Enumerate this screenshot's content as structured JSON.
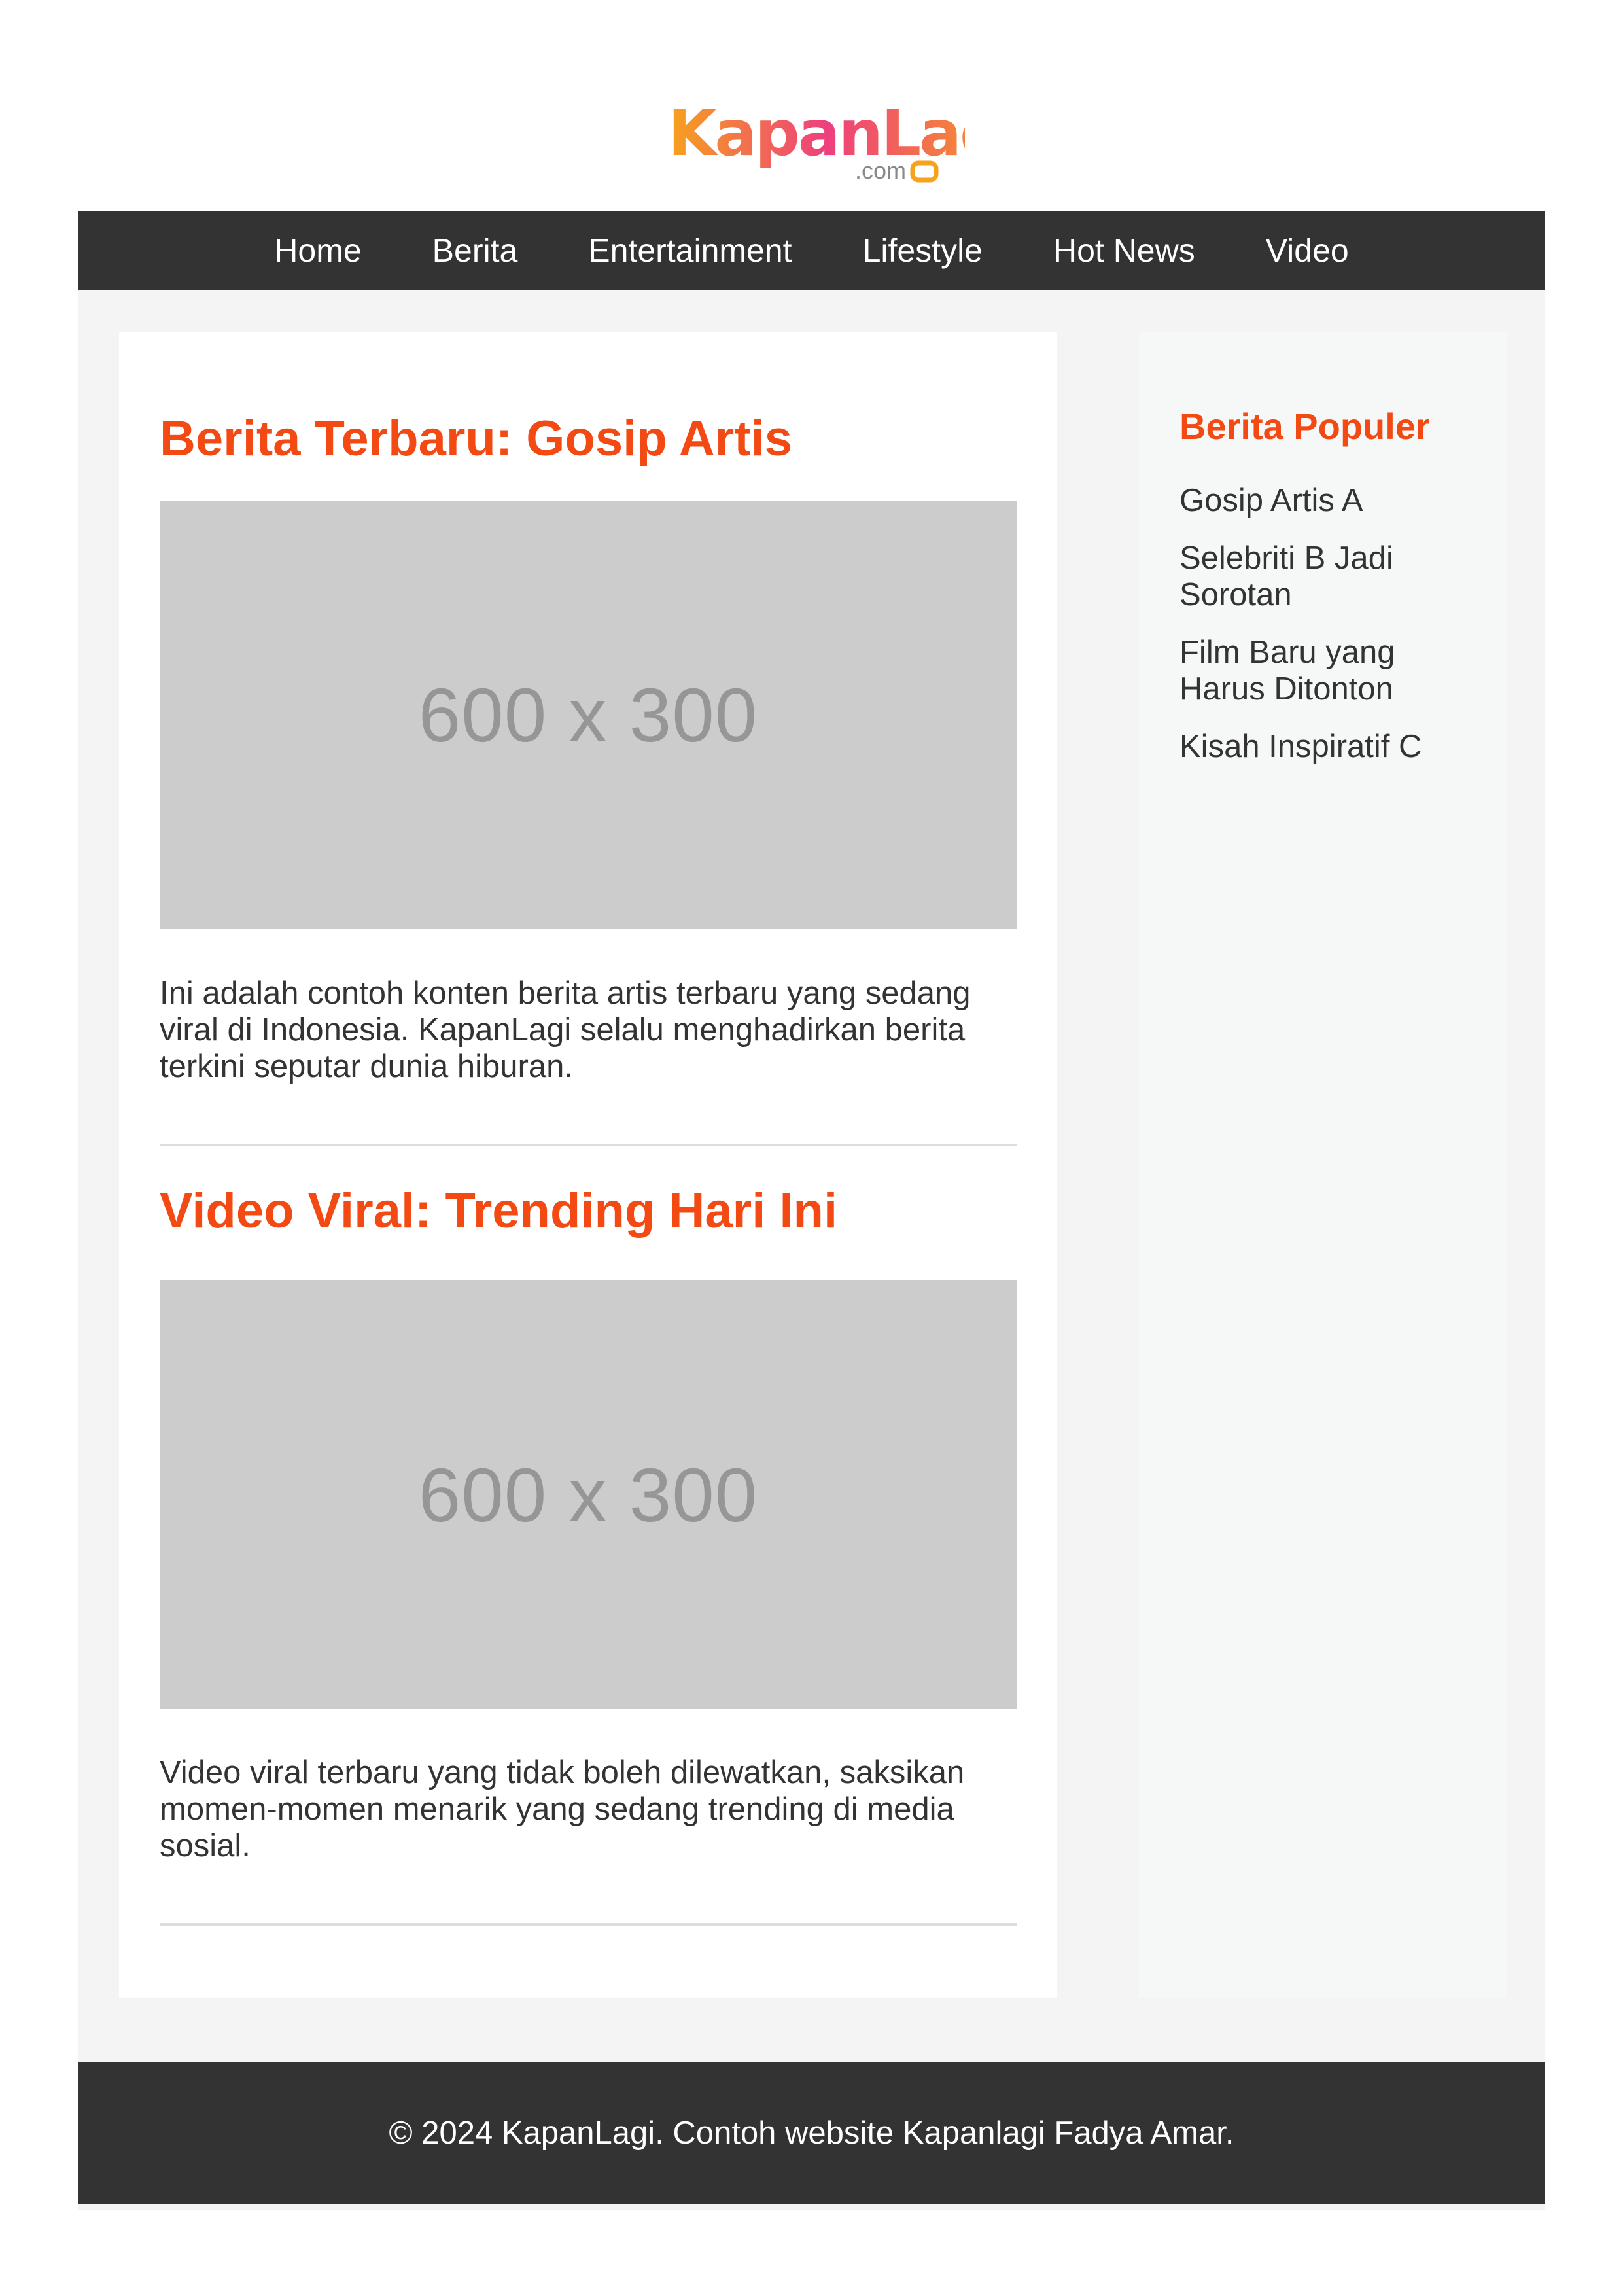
{
  "brand": {
    "logo_text": "KapanLagi",
    "logo_suffix": ".com",
    "accent_color": "#f24a12"
  },
  "nav": {
    "items": [
      "Home",
      "Berita",
      "Entertainment",
      "Lifestyle",
      "Hot News",
      "Video"
    ]
  },
  "articles": [
    {
      "title": "Berita Terbaru: Gosip Artis",
      "image_placeholder": "600 x 300",
      "text": "Ini adalah contoh konten berita artis terbaru yang sedang viral di Indonesia. KapanLagi selalu menghadirkan berita terkini seputar dunia hiburan."
    },
    {
      "title": "Video Viral: Trending Hari Ini",
      "image_placeholder": "600 x 300",
      "text": "Video viral terbaru yang tidak boleh dilewatkan, saksikan momen-momen menarik yang sedang trending di media sosial."
    }
  ],
  "sidebar": {
    "title": "Berita Populer",
    "items": [
      "Gosip Artis A",
      "Selebriti B Jadi Sorotan",
      "Film Baru yang Harus Ditonton",
      "Kisah Inspiratif C"
    ]
  },
  "footer": {
    "text": "© 2024 KapanLagi. Contoh website Kapanlagi Fadya Amar."
  }
}
